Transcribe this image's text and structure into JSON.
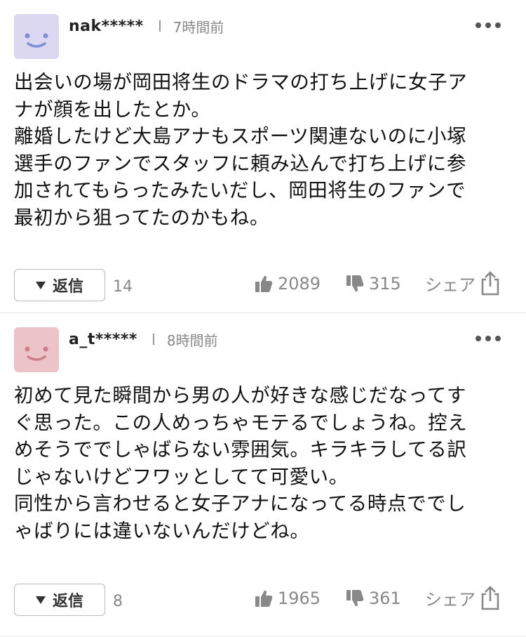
{
  "comments": [
    {
      "username": "nak*****",
      "time": "7時間前",
      "avatar_color": "#dcd8f2",
      "avatar_face_color": "#7f8fd6",
      "text": "出会いの場が岡田将生のドラマの打ち上げに女子ア\nナが顔を出したとか。\n離婚したけど大島アナもスポーツ関連ないのに小塚\n選手のファンでスタッフに頼み込んで打ち上げに参\n加されてもらったみたいだし、岡田将生のファンで\n最初から狙ってたのかもね。",
      "reply_label": "返信",
      "reply_count": "14",
      "likes": "2089",
      "dislikes": "315",
      "share_label": "シェア"
    },
    {
      "username": "a_t*****",
      "time": "8時間前",
      "avatar_color": "#ecc4c8",
      "avatar_face_color": "#cc7f86",
      "text": "初めて見た瞬間から男の人が好きな感じだなってす\nぐ思った。この人めっちゃモテるでしょうね。控え\nめそうででしゃばらない雰囲気。キラキラしてる訳\nじゃないけどフワッとしてて可愛い。\n同性から言わせると女子アナになってる時点ででし\nゃばりには違いないんだけどね。",
      "reply_label": "返信",
      "reply_count": "8",
      "likes": "1965",
      "dislikes": "361",
      "share_label": "シェア"
    }
  ],
  "icons": {
    "more": "more-dots-icon",
    "thumb_up": "thumbs-up-icon",
    "thumb_down": "thumbs-down-icon",
    "share": "share-icon"
  }
}
